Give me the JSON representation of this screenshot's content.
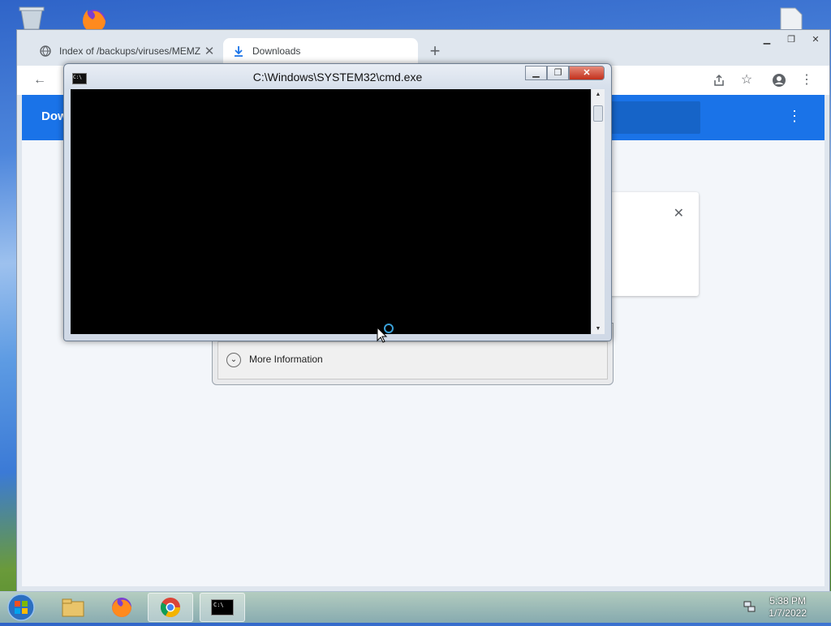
{
  "desktop": {
    "icons": [
      {
        "name": "recycle-bin-icon",
        "label": ""
      },
      {
        "name": "firefox-desktop-icon",
        "label": ""
      },
      {
        "name": "document-desktop-icon",
        "label": ""
      }
    ]
  },
  "chrome": {
    "tabs": [
      {
        "title": "Index of /backups/viruses/MEMZ",
        "icon": "globe-icon",
        "active": false
      },
      {
        "title": "Downloads",
        "icon": "download-icon",
        "active": true
      }
    ],
    "page_title": "Dow",
    "window_controls": {
      "minimize": "▁",
      "maximize": "❐",
      "close": "✕"
    }
  },
  "dialog": {
    "more_information_label": "More Information"
  },
  "cmd": {
    "title": "C:\\Windows\\SYSTEM32\\cmd.exe",
    "icon_text": "C:\\",
    "buttons": {
      "minimize": "▁",
      "maximize": "❐",
      "close": "✕"
    }
  },
  "taskbar": {
    "apps": [
      {
        "name": "file-explorer-icon"
      },
      {
        "name": "firefox-icon"
      },
      {
        "name": "chrome-icon"
      },
      {
        "name": "cmd-taskbar-icon"
      }
    ],
    "cmd_icon_text": "C:\\",
    "clock": {
      "time": "5:38 PM",
      "date": "1/7/2022"
    }
  },
  "colors": {
    "chrome_blue": "#1a73e8",
    "console_bg": "#000000",
    "close_red": "#c3301b"
  }
}
